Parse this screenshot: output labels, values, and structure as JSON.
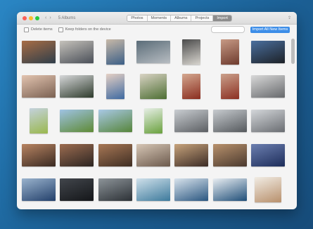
{
  "window": {
    "title_left": "5 Albums",
    "tabs": [
      {
        "label": "Photos",
        "active": false
      },
      {
        "label": "Moments",
        "active": false
      },
      {
        "label": "Albums",
        "active": false
      },
      {
        "label": "Projects",
        "active": false
      },
      {
        "label": "Import",
        "active": true
      }
    ]
  },
  "toolbar": {
    "delete_label": "Delete items",
    "keep_label": "Keep folders on the device",
    "import_label": "Import All New Items"
  },
  "photos": [
    {
      "type": "landscape",
      "colors": [
        "#2f3e4a",
        "#a86d45"
      ]
    },
    {
      "type": "landscape",
      "colors": [
        "#4a4f58",
        "#c5c2bb"
      ]
    },
    {
      "type": "portrait",
      "colors": [
        "#3c5f87",
        "#c8b9a8"
      ]
    },
    {
      "type": "landscape",
      "colors": [
        "#b8bdc2",
        "#5a6c78"
      ]
    },
    {
      "type": "portrait",
      "colors": [
        "#d8d5cf",
        "#4a4a4a"
      ]
    },
    {
      "type": "portrait",
      "colors": [
        "#6e3b2e",
        "#c79a85"
      ]
    },
    {
      "type": "landscape",
      "colors": [
        "#1d2127",
        "#4a6f9e"
      ]
    },
    {
      "type": "landscape",
      "colors": [
        "#7a6152",
        "#e3c4b0"
      ]
    },
    {
      "type": "landscape",
      "colors": [
        "#2e3b2c",
        "#d7d8da"
      ]
    },
    {
      "type": "portrait",
      "colors": [
        "#3f6aa1",
        "#e5d0c4"
      ]
    },
    {
      "type": "square",
      "colors": [
        "#4d6e33",
        "#d9d3c4"
      ]
    },
    {
      "type": "portrait",
      "colors": [
        "#8a2d1f",
        "#d4a890"
      ]
    },
    {
      "type": "portrait",
      "colors": [
        "#8c3022",
        "#caa08b"
      ]
    },
    {
      "type": "landscape",
      "colors": [
        "#67696c",
        "#d9d9d9"
      ]
    },
    {
      "type": "portrait",
      "colors": [
        "#9ab84e",
        "#c4d2dd"
      ]
    },
    {
      "type": "landscape",
      "colors": [
        "#5e8a35",
        "#9fc3e4"
      ]
    },
    {
      "type": "landscape",
      "colors": [
        "#56853a",
        "#a9c9e6"
      ]
    },
    {
      "type": "portrait",
      "colors": [
        "#6aa13e",
        "#e7efe6"
      ]
    },
    {
      "type": "landscape",
      "colors": [
        "#5c5f63",
        "#c9cdd1"
      ]
    },
    {
      "type": "landscape",
      "colors": [
        "#55595d",
        "#c7cbcf"
      ]
    },
    {
      "type": "landscape",
      "colors": [
        "#6a6d72",
        "#d4d7da"
      ]
    },
    {
      "type": "landscape",
      "colors": [
        "#3a2a22",
        "#b88462"
      ]
    },
    {
      "type": "landscape",
      "colors": [
        "#2c2522",
        "#9c6c50"
      ]
    },
    {
      "type": "landscape",
      "colors": [
        "#3f2e23",
        "#a77755"
      ]
    },
    {
      "type": "landscape",
      "colors": [
        "#6c5a4d",
        "#d6c6b5"
      ]
    },
    {
      "type": "landscape",
      "colors": [
        "#3c2c26",
        "#c7a37b"
      ]
    },
    {
      "type": "landscape",
      "colors": [
        "#4b3a2f",
        "#b8916c"
      ]
    },
    {
      "type": "landscape",
      "colors": [
        "#1d2d5a",
        "#6c7fb0"
      ]
    },
    {
      "type": "landscape",
      "colors": [
        "#23406b",
        "#9ab3cd"
      ]
    },
    {
      "type": "landscape",
      "colors": [
        "#141619",
        "#42464c"
      ]
    },
    {
      "type": "landscape",
      "colors": [
        "#2c3136",
        "#8d9499"
      ]
    },
    {
      "type": "landscape",
      "colors": [
        "#3d7a9c",
        "#cfe0ea"
      ]
    },
    {
      "type": "landscape",
      "colors": [
        "#2a5680",
        "#d8e3ec"
      ]
    },
    {
      "type": "landscape",
      "colors": [
        "#1f4e78",
        "#e9eef2"
      ]
    },
    {
      "type": "square",
      "colors": [
        "#b8906c",
        "#f1ece4"
      ]
    }
  ]
}
